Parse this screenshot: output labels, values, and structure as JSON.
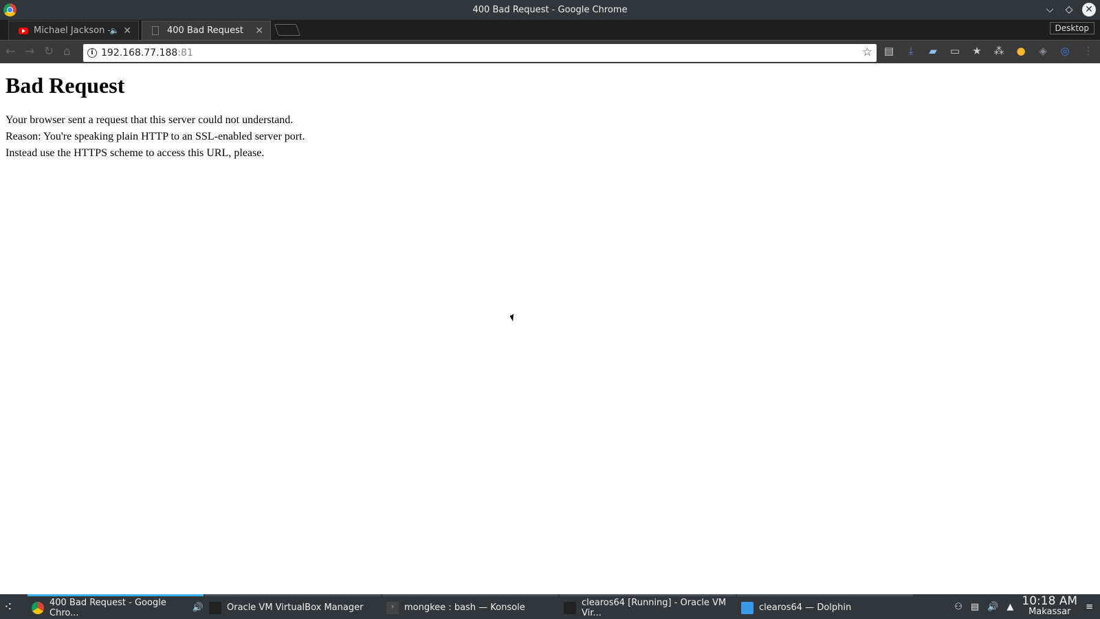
{
  "window": {
    "title": "400 Bad Request - Google Chrome"
  },
  "tabs": [
    {
      "label": "Michael Jackson - Th",
      "favicon": "youtube-icon",
      "audio": true
    },
    {
      "label": "400 Bad Request",
      "favicon": "document-icon",
      "active": true
    }
  ],
  "desktop_label": "Desktop",
  "omnibox": {
    "host": "192.168.77.188",
    "port": ":81"
  },
  "extensions": [
    "extension-doc-icon",
    "extension-download-icon",
    "extension-folder-icon",
    "extension-reader-icon",
    "extension-star-icon",
    "extension-dots-icon",
    "extension-emoji-icon",
    "extension-tag-icon",
    "extension-sync-icon"
  ],
  "page": {
    "heading": "Bad Request",
    "lines": [
      "Your browser sent a request that this server could not understand.",
      "Reason: You're speaking plain HTTP to an SSL-enabled server port.",
      "Instead use the HTTPS scheme to access this URL, please."
    ]
  },
  "taskbar": {
    "tasks": [
      {
        "label": "400 Bad Request - Google Chro...",
        "icon": "chrome-icon"
      },
      {
        "label": "Oracle VM VirtualBox Manager",
        "icon": "virtualbox-icon"
      },
      {
        "label": "mongkee : bash — Konsole",
        "icon": "terminal-icon"
      },
      {
        "label": "clearos64 [Running] - Oracle VM Vir...",
        "icon": "virtualbox-icon"
      },
      {
        "label": "clearos64 — Dolphin",
        "icon": "folder-icon"
      }
    ],
    "clock": {
      "time": "10:18 AM",
      "timezone": "Makassar"
    }
  },
  "colors": {
    "accent": "#3daee9",
    "panel": "#31363b"
  }
}
